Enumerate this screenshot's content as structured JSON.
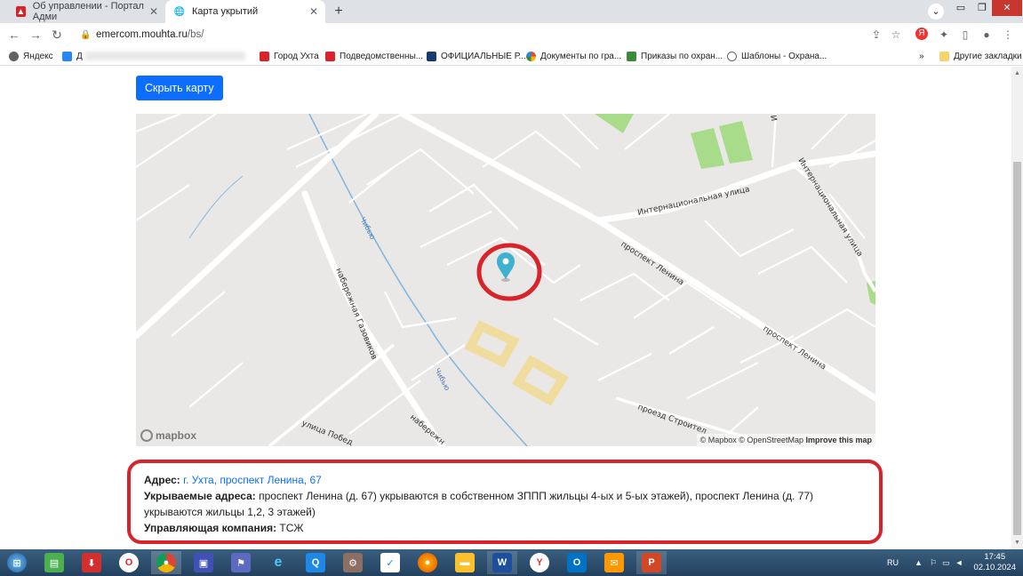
{
  "browser": {
    "tabs": [
      {
        "title": "Об управлении - Портал Адми",
        "active": false
      },
      {
        "title": "Карта укрытий",
        "active": true
      }
    ],
    "url_host": "emercom.mouhta.ru",
    "url_path": "/bs/",
    "bookmarks": [
      {
        "label": "Яндекс",
        "color": "#5f6368"
      },
      {
        "label": "Д",
        "color": "#2787f5"
      },
      {
        "label": "Город Ухта",
        "color": "#d8232a"
      },
      {
        "label": "Подведомственны...",
        "color": "#d8232a"
      },
      {
        "label": "ОФИЦИАЛЬНЫЕ Р...",
        "color": "#1a3b6f"
      },
      {
        "label": "Документы по гра...",
        "color": "#e04a3a"
      },
      {
        "label": "Приказы по охран...",
        "color": "#3a8a3a"
      },
      {
        "label": "Шаблоны - Охрана...",
        "color": "#5f6368"
      }
    ],
    "other_bookmarks": "Другие закладки"
  },
  "page": {
    "hide_map_button": "Скрыть карту",
    "map": {
      "street_labels": {
        "international": "Интернациональная улица",
        "international_v": "Интернациональная улица",
        "lenina1": "проспект Ленина",
        "lenina2": "проспект Ленина",
        "naberezhnaya": "набережная Газовиков",
        "naberezhnaya2": "набережн",
        "chibyu1": "Чибью",
        "chibyu2": "Чибью",
        "proezd": "проезд Строител",
        "pobedy": "улица Побед",
        "i_label": "И"
      },
      "logo": "mapbox",
      "attribution_mapbox": "© Mapbox",
      "attribution_osm": "© OpenStreetMap",
      "attribution_improve": "Improve this map"
    },
    "info": {
      "address_label": "Адрес:",
      "address_value": "г. Ухта, проспект Ленина, 67",
      "sheltered_label": "Укрываемые адреса:",
      "sheltered_value": "проспект Ленина (д. 67) укрываются в собственном ЗППП жильцы 4-ых и 5-ых этажей), проспект Ленина (д. 77) укрываются жильцы 1,2, 3 этажей)",
      "company_label": "Управляющая компания:",
      "company_value": "ТСЖ"
    }
  },
  "taskbar": {
    "lang": "RU",
    "time": "17:45",
    "date": "02.10.2024"
  },
  "colors": {
    "accent": "#0d6efd",
    "highlight_red": "#d8232a",
    "marker": "#3fb1ce",
    "map_bg": "#e9e8e6",
    "park": "#a8dc8a",
    "building": "#f1dca0"
  }
}
